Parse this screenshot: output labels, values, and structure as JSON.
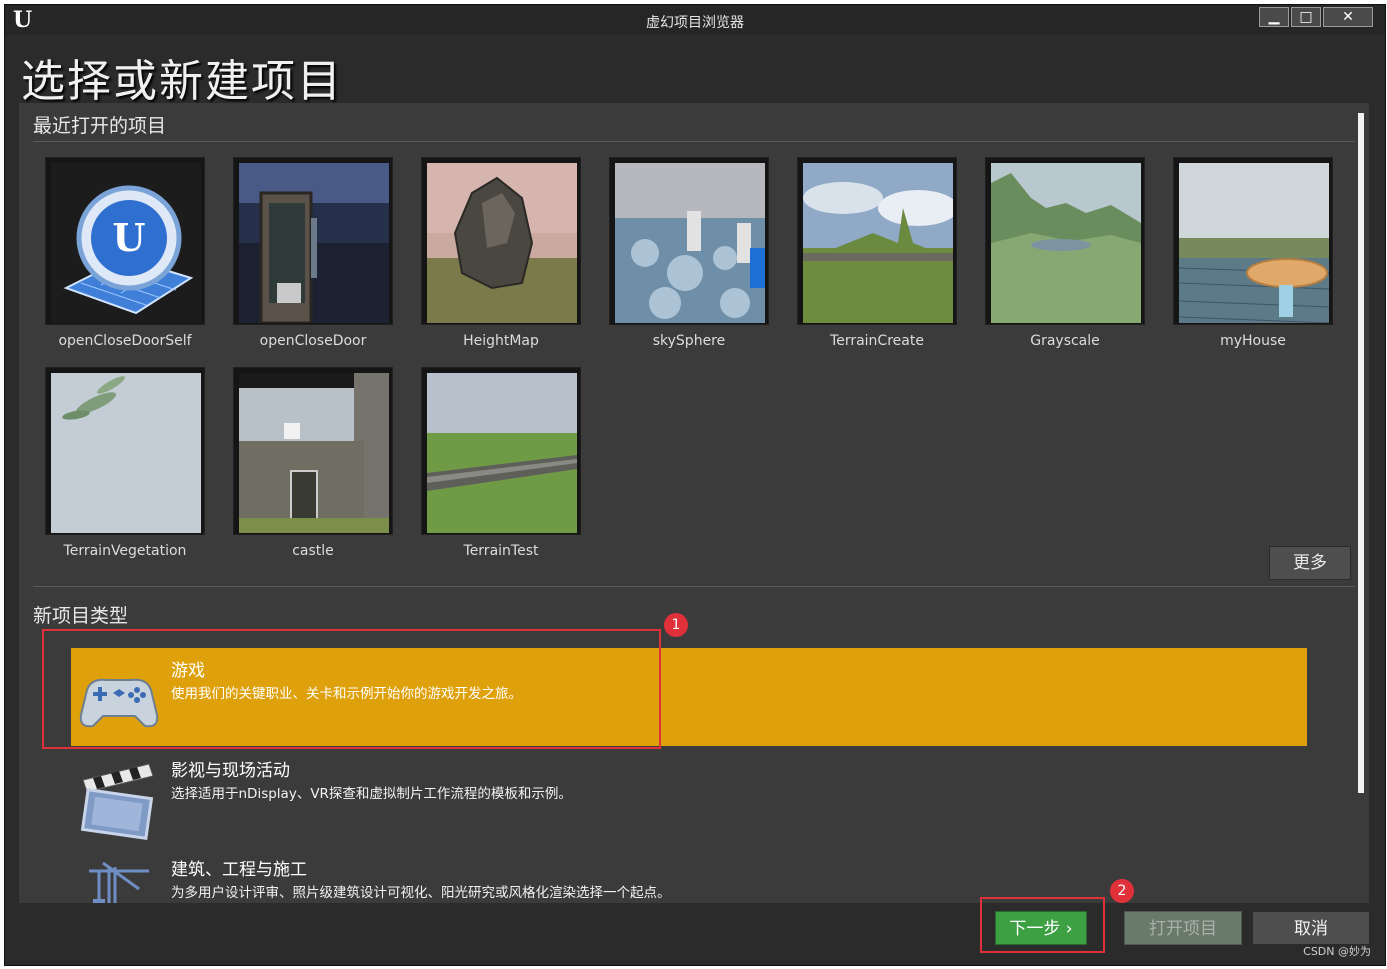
{
  "window": {
    "title": "虚幻项目浏览器",
    "heading": "选择或新建项目"
  },
  "recent": {
    "title": "最近打开的项目",
    "projects": [
      {
        "name": "openCloseDoorSelf"
      },
      {
        "name": "openCloseDoor"
      },
      {
        "name": "HeightMap"
      },
      {
        "name": "skySphere"
      },
      {
        "name": "TerrainCreate"
      },
      {
        "name": "Grayscale"
      },
      {
        "name": "myHouse"
      },
      {
        "name": "TerrainVegetation"
      },
      {
        "name": "castle"
      },
      {
        "name": "TerrainTest"
      }
    ],
    "more_label": "更多"
  },
  "new_types": {
    "title": "新项目类型",
    "items": [
      {
        "name": "游戏",
        "desc": "使用我们的关键职业、关卡和示例开始你的游戏开发之旅。",
        "icon": "gamepad-icon",
        "selected": true
      },
      {
        "name": "影视与现场活动",
        "desc": "选择适用于nDisplay、VR探查和虚拟制片工作流程的模板和示例。",
        "icon": "clapperboard-icon",
        "selected": false
      },
      {
        "name": "建筑、工程与施工",
        "desc": "为多用户设计评审、照片级建筑设计可视化、阳光研究或风格化渲染选择一个起点。",
        "icon": "crane-icon",
        "selected": false
      }
    ]
  },
  "footer": {
    "next_label": "下一步",
    "open_label": "打开项目",
    "cancel_label": "取消"
  },
  "annotations": {
    "marker1": "1",
    "marker2": "2",
    "color": "#e0303a"
  },
  "watermark": "CSDN @妙为",
  "colors": {
    "selected": "#dea10b",
    "next_button": "#3da143"
  }
}
